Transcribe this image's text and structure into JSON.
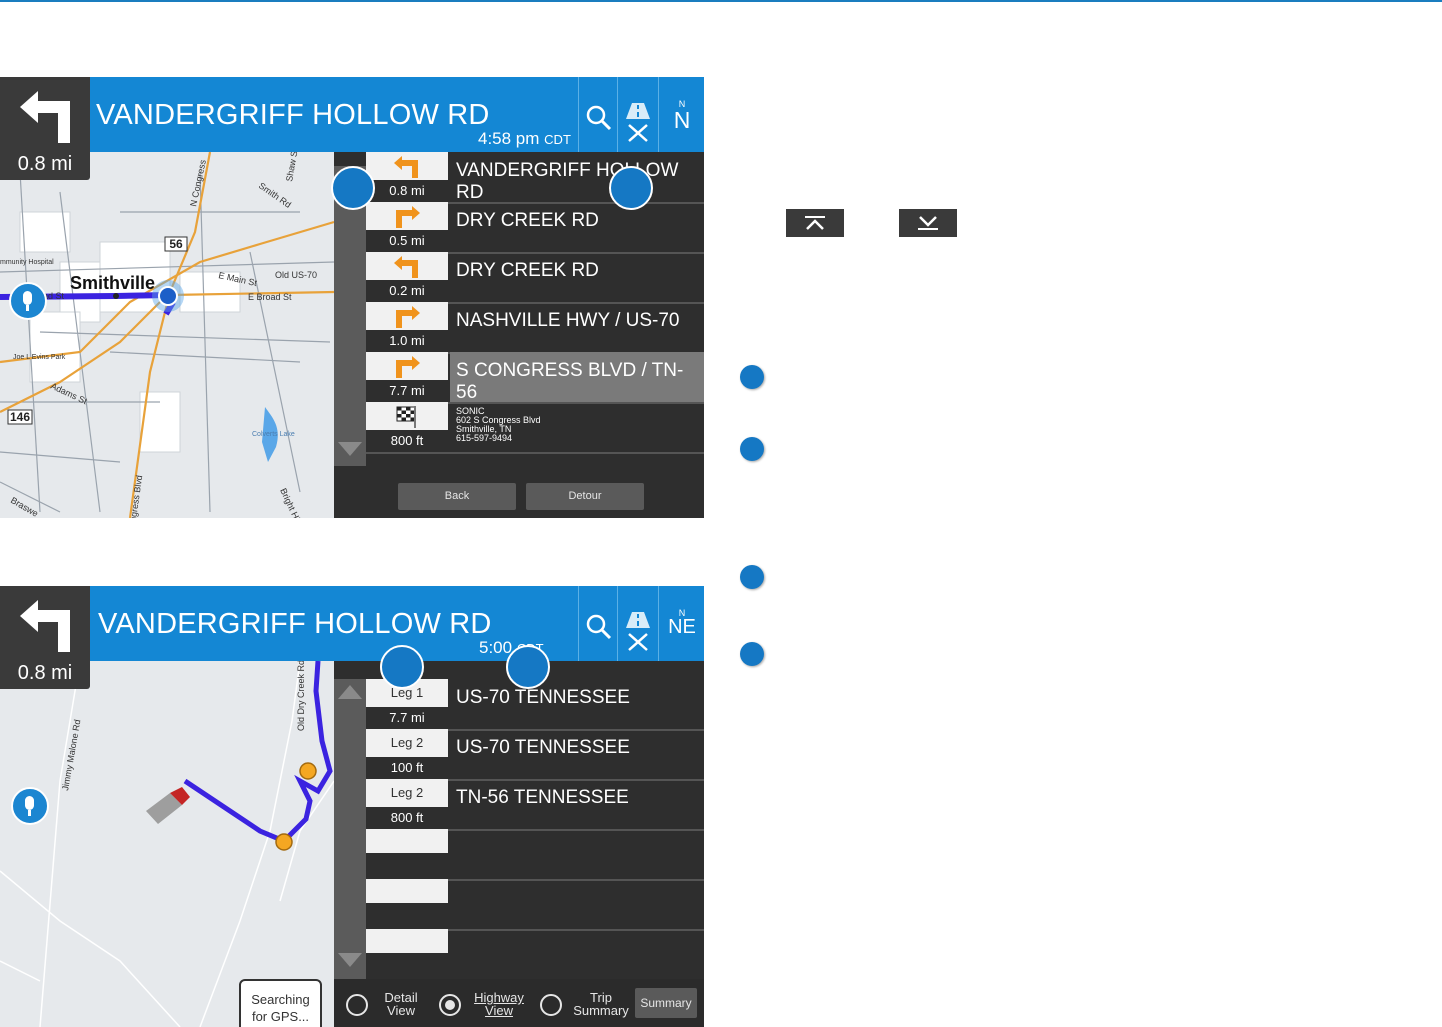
{
  "screen1": {
    "maneuver_distance": "0.8 mi",
    "road_name": "VANDERGRIFF HOLLOW RD",
    "time": "4:58 pm",
    "time_zone": "CDT",
    "compass_small": "N",
    "compass_heading": "N",
    "map_labels": {
      "town": "Smithville",
      "hospital": "mmunity Hospital",
      "road_st": "oad St",
      "e_main": "E Main St",
      "old_us70": "Old US-70",
      "e_broad": "E Broad St",
      "n_congress": "N Congress",
      "smith_rd": "Smith Rd",
      "shaw": "Shaw S",
      "route56": "56",
      "route146": "146",
      "park": "Joe L Evins Park",
      "lake": "Colverts Lake",
      "adams": "Adams St",
      "s_congress": "S Congress Blvd",
      "bright_hill": "Bright Hill Rd",
      "braswell": "Braswe"
    },
    "turns": [
      {
        "dist": "0.8 mi",
        "name": "VANDERGRIFF HOLLOW RD",
        "icon": "turn-left-arrow"
      },
      {
        "dist": "0.5 mi",
        "name": "DRY CREEK RD",
        "icon": "turn-right-arrow"
      },
      {
        "dist": "0.2 mi",
        "name": "DRY CREEK RD",
        "icon": "turn-left-arrow"
      },
      {
        "dist": "1.0 mi",
        "name": "NASHVILLE HWY / US-70",
        "icon": "turn-right-arrow"
      },
      {
        "dist": "7.7 mi",
        "name": "S CONGRESS BLVD / TN-56",
        "icon": "turn-right-arrow"
      },
      {
        "dist": "800 ft",
        "icon": "checkered-flag",
        "dest_name": "SONIC",
        "dest_addr": "602 S Congress Blvd",
        "dest_city": "Smithville, TN",
        "dest_phone": "615-597-9494"
      }
    ],
    "back_label": "Back",
    "detour_label": "Detour"
  },
  "screen2": {
    "maneuver_distance": "0.8 mi",
    "road_name": "VANDERGRIFF HOLLOW RD",
    "time": "5:00",
    "time_zone": "CDT",
    "compass_small": "N",
    "compass_heading": "NE",
    "map_labels": {
      "old_dry_creek": "Old Dry Creek Rd",
      "jimmy_malone": "Jimmy Malone Rd"
    },
    "gps_line1": "Searching",
    "gps_line2": "for GPS...",
    "legs": [
      {
        "leg": "Leg 1",
        "dist": "7.7 mi",
        "name": "US-70 TENNESSEE"
      },
      {
        "leg": "Leg 2",
        "dist": "100 ft",
        "name": "US-70 TENNESSEE"
      },
      {
        "leg": "Leg 2",
        "dist": "800 ft",
        "name": "TN-56 TENNESSEE"
      }
    ],
    "views": {
      "detail_1": "Detail",
      "detail_2": "View",
      "highway_1": "Highway",
      "highway_2": "View",
      "trip_1": "Trip",
      "trip_2": "Summary",
      "summary": "Summary"
    }
  },
  "colors": {
    "header_blue": "#1487d4",
    "panel_dark": "#2e2e2e",
    "route_blue": "#3b23e0",
    "callout_blue": "#1578c4",
    "turn_orange": "#f0931c"
  }
}
